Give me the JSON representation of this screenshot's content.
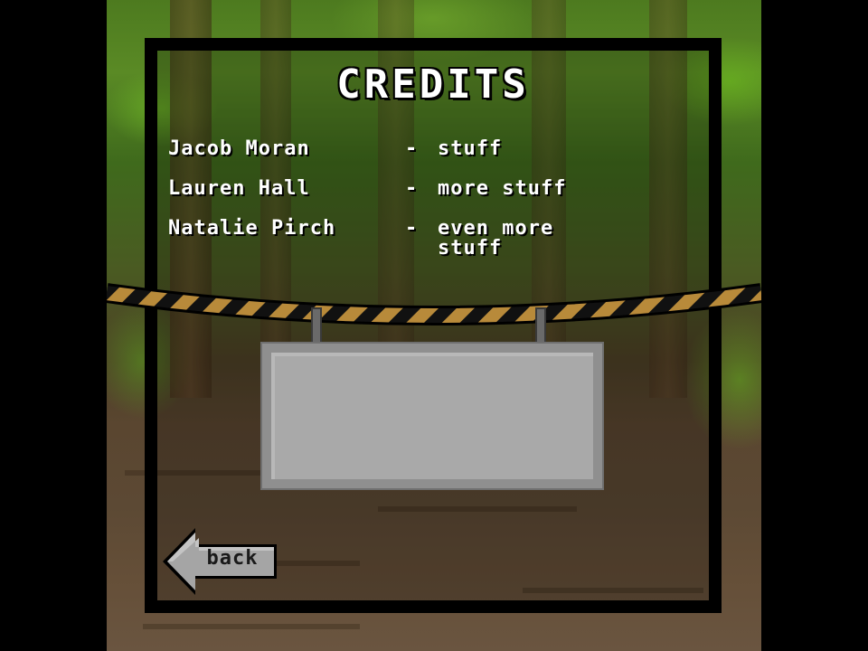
{
  "screen": {
    "title": "CREDITS"
  },
  "credits": [
    {
      "name": "Jacob Moran",
      "dash": "-",
      "role": "stuff"
    },
    {
      "name": "Lauren Hall",
      "dash": "-",
      "role": "more stuff"
    },
    {
      "name": "Natalie Pirch",
      "dash": "-",
      "role": "even more stuff"
    }
  ],
  "sign": {
    "text": ""
  },
  "back_button": {
    "label": "back",
    "icon": "left-arrow-icon"
  },
  "colors": {
    "text": "#ffffff",
    "panel_border": "#000000",
    "rope_dark": "#111111",
    "rope_light": "#b88a3a",
    "sign_face": "#a9a9a9",
    "button_face": "#a5a5a5"
  }
}
